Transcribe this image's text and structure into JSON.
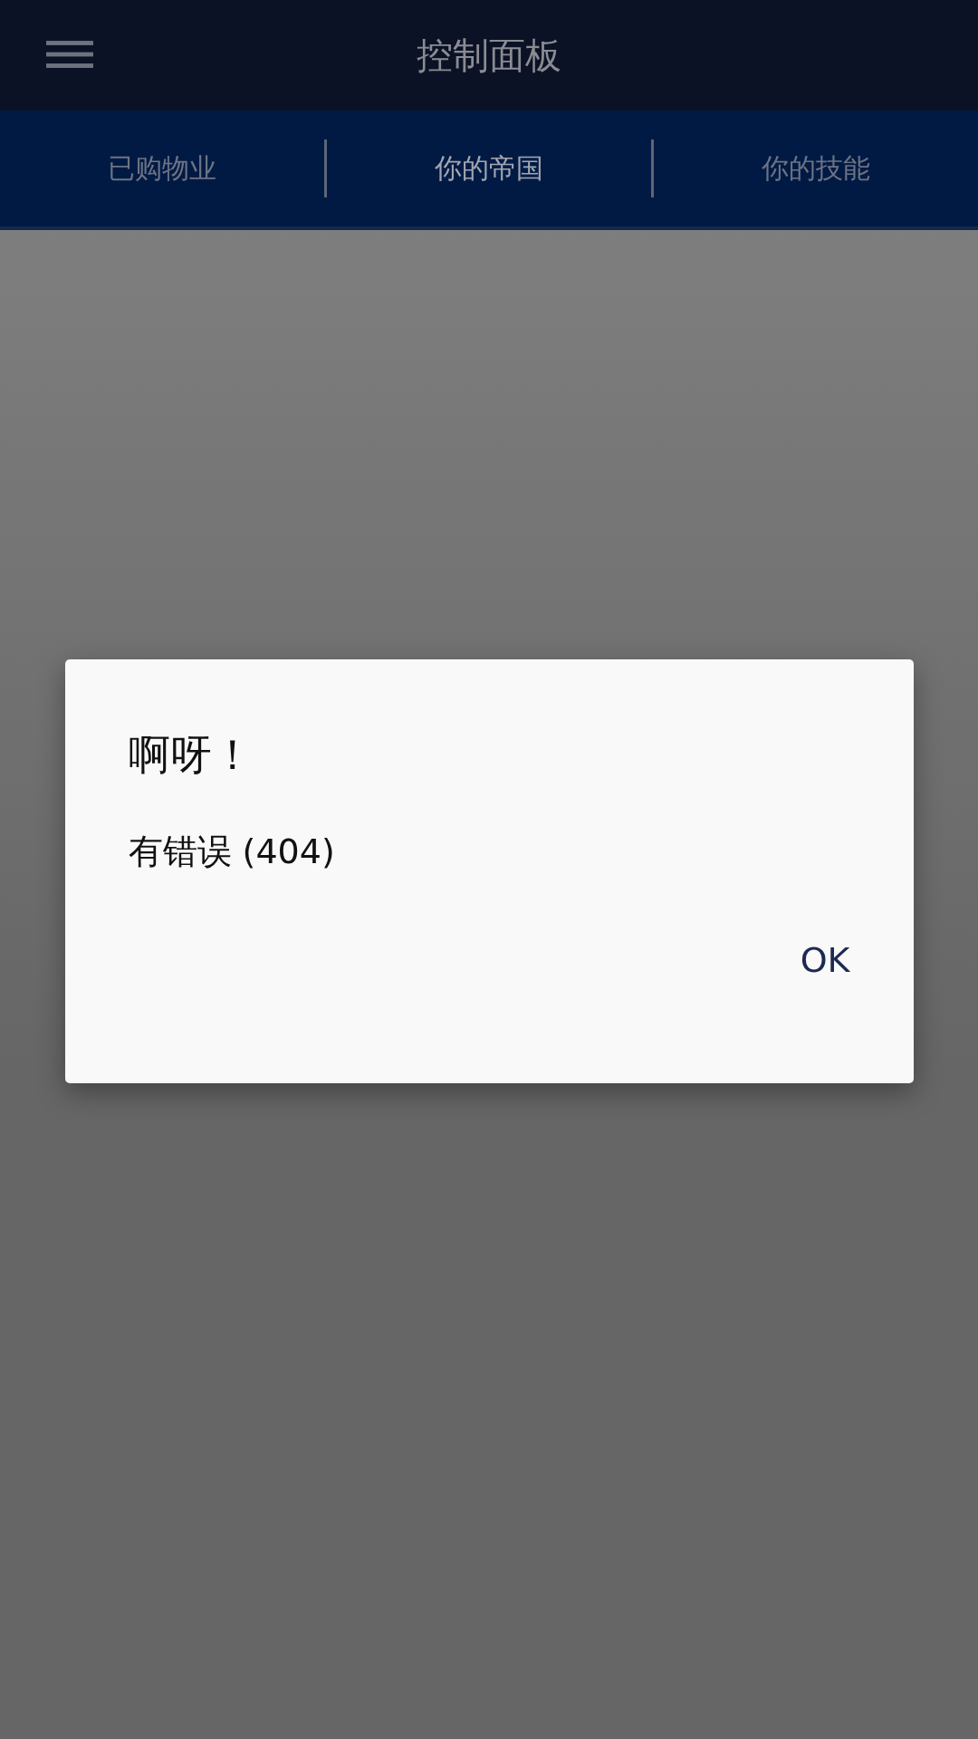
{
  "header": {
    "title": "控制面板"
  },
  "tabs": [
    {
      "label": "已购物业",
      "selected": false
    },
    {
      "label": "你的帝国",
      "selected": true
    },
    {
      "label": "你的技能",
      "selected": false
    }
  ],
  "dialog": {
    "title": "啊呀！",
    "message": "有错误 (404)",
    "button": "OK"
  }
}
